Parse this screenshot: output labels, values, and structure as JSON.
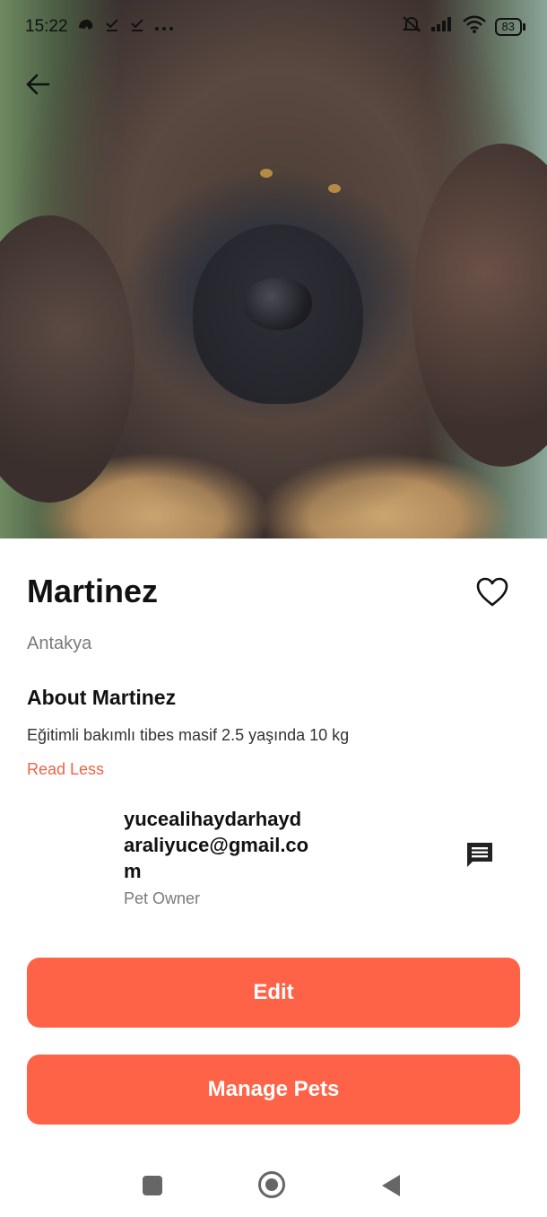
{
  "status_bar": {
    "time": "15:22",
    "battery": "83"
  },
  "pet": {
    "name": "Martinez",
    "location": "Antakya",
    "about_title": "About Martinez",
    "about_text": "Eğitimli bakımlı tibes masif 2.5 yaşında 10 kg",
    "read_less": "Read Less"
  },
  "owner": {
    "email": "yucealihaydarhaydaraliyuce@gmail.com",
    "role": "Pet Owner"
  },
  "buttons": {
    "edit": "Edit",
    "manage_pets": "Manage Pets"
  },
  "colors": {
    "accent": "#ff6347",
    "link": "#ee6347"
  },
  "icons": [
    "back-arrow-icon",
    "heart-outline-icon",
    "chat-icon",
    "nav-recents-icon",
    "nav-home-icon",
    "nav-back-icon"
  ]
}
